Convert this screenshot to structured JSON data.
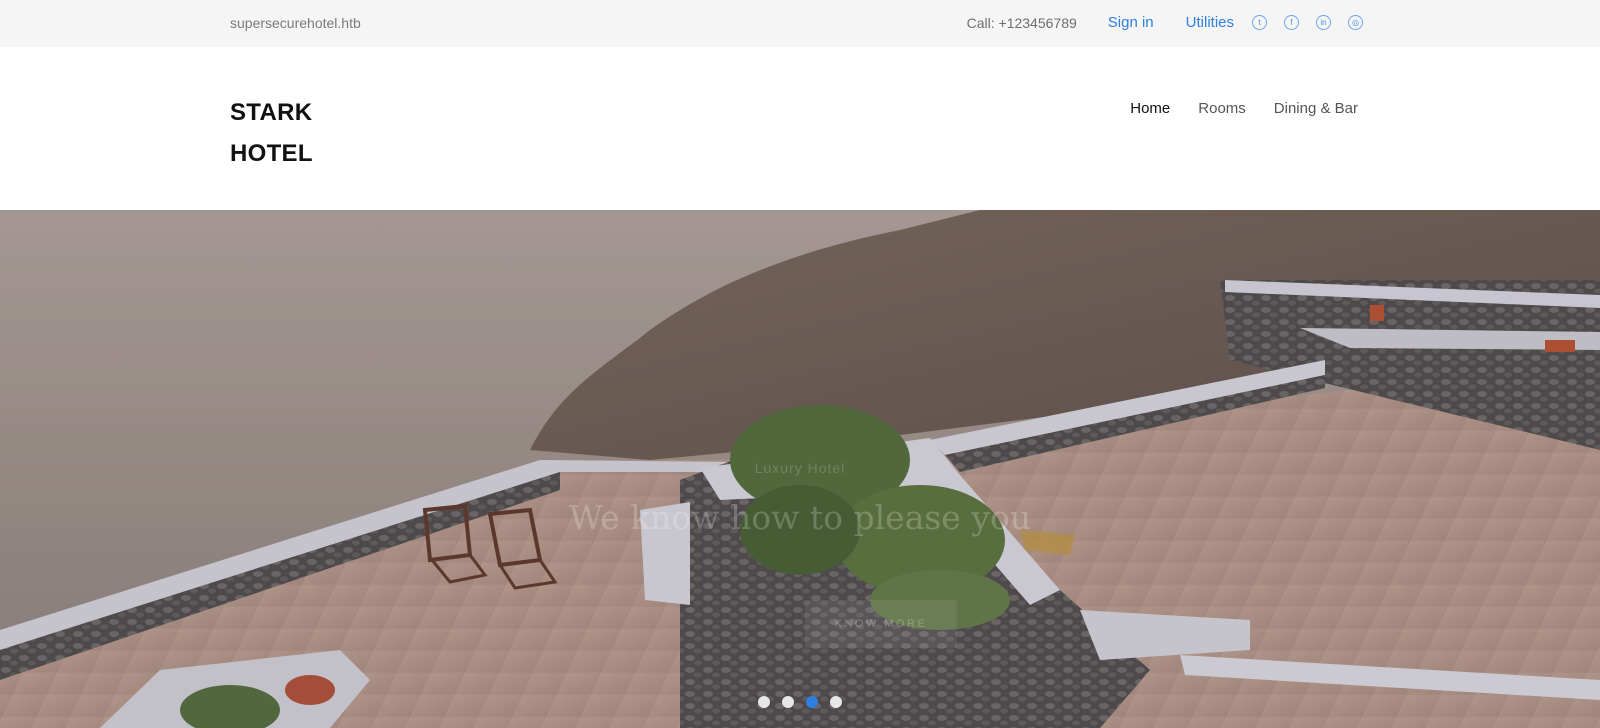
{
  "topbar": {
    "domain": "supersecurehotel.htb",
    "call": "Call: +123456789",
    "sign_in": "Sign in",
    "utilities": "Utilities",
    "social": [
      {
        "icon": "twitter-icon",
        "glyph": "t"
      },
      {
        "icon": "facebook-icon",
        "glyph": "f"
      },
      {
        "icon": "linkedin-icon",
        "glyph": "in"
      },
      {
        "icon": "dribbble-icon",
        "glyph": "◎"
      }
    ]
  },
  "brand": {
    "line1": "STARK",
    "line2": "HOTEL"
  },
  "nav": {
    "items": [
      "Home",
      "Rooms",
      "Dining & Bar"
    ],
    "active": "Home"
  },
  "hero": {
    "kicker": "Luxury Hotel",
    "headline": "We know how to please you",
    "cta": "Know More",
    "slides": 4,
    "active_slide": 3
  },
  "colors": {
    "accent": "#2d7fe0",
    "topbar_bg": "#f5f5f5"
  }
}
